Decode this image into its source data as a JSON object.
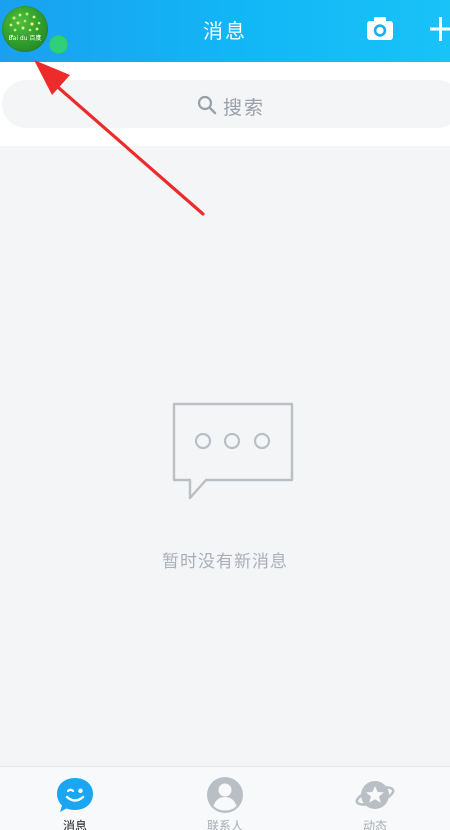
{
  "colors": {
    "header_gradient_start": "#1aa0f0",
    "header_gradient_end": "#19c2f7",
    "background": "#f3f5f7",
    "online_indicator": "#2fd07a",
    "annotation_arrow": "#ee2b2b",
    "inactive_tab": "#a6acb2",
    "active_tab_label": "#222222",
    "active_tab_icon": "#1aa6f2"
  },
  "header": {
    "title": "消息",
    "avatar_icon": "avatar",
    "avatar_text": "Bai du 百度",
    "camera_icon": "camera-icon",
    "add_icon": "plus-icon"
  },
  "search": {
    "placeholder": "搜索",
    "icon": "search-icon"
  },
  "empty_state": {
    "icon": "chat-bubble-icon",
    "message": "暂时没有新消息"
  },
  "annotation": {
    "type": "arrow",
    "points_to": "avatar"
  },
  "tabbar": {
    "tabs": [
      {
        "label": "消息",
        "icon": "message-face-icon",
        "active": true
      },
      {
        "label": "联系人",
        "icon": "contacts-icon",
        "active": false
      },
      {
        "label": "动态",
        "icon": "planet-star-icon",
        "active": false
      }
    ]
  }
}
